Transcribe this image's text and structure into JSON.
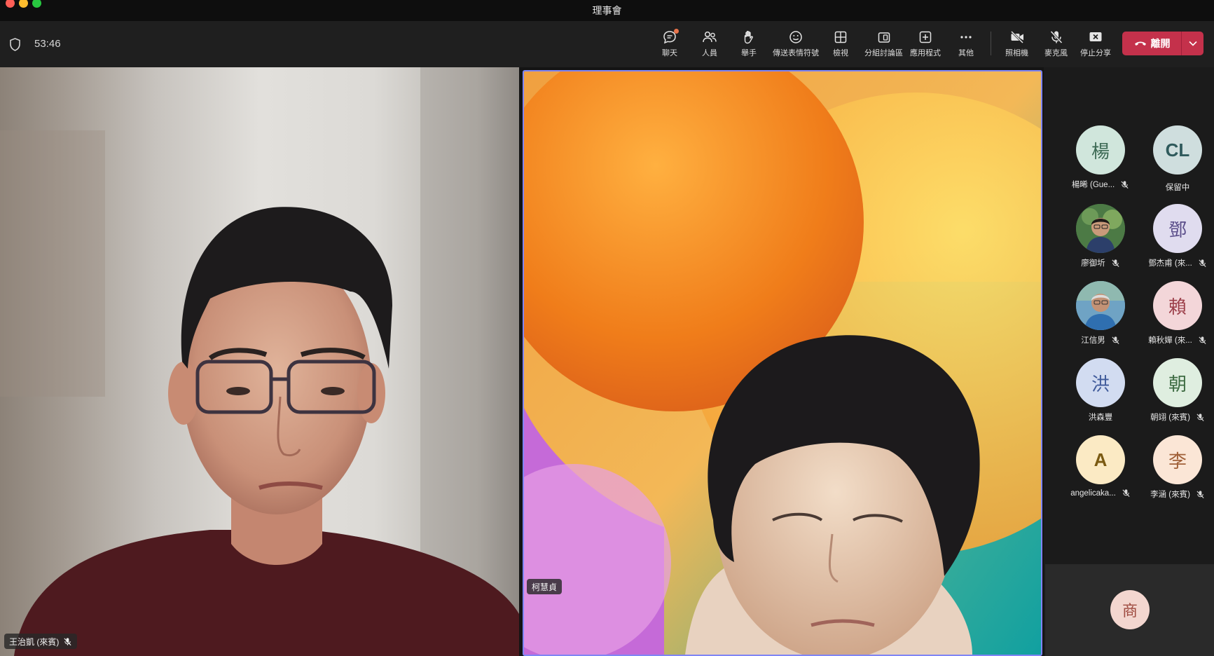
{
  "window": {
    "title": "理事會"
  },
  "meeting": {
    "timer": "53:46"
  },
  "toolbar": {
    "chat": "聊天",
    "people": "人員",
    "raise_hand": "舉手",
    "reactions": "傳送表情符號",
    "view": "檢視",
    "breakout": "分組討論區",
    "apps": "應用程式",
    "more": "其他",
    "camera": "照相機",
    "mic": "麥克風",
    "stop_share": "停止分享",
    "leave": "離開"
  },
  "stage": {
    "left_name": "王治凱 (來賓)",
    "right_name": "柯慧貞"
  },
  "roster": [
    {
      "initial": "楊",
      "name": "楊晞 (Gue...",
      "muted": true
    },
    {
      "initial": "CL",
      "name": "保留中",
      "muted": false
    },
    {
      "initial": "",
      "name": "廖御圻",
      "muted": true
    },
    {
      "initial": "鄧",
      "name": "鄧杰甫 (來...",
      "muted": true
    },
    {
      "initial": "",
      "name": "江信男",
      "muted": true
    },
    {
      "initial": "賴",
      "name": "賴秋嬋 (來...",
      "muted": true
    },
    {
      "initial": "洪",
      "name": "洪森豐",
      "muted": false
    },
    {
      "initial": "朝",
      "name": "朝翊 (來賓)",
      "muted": true
    },
    {
      "initial": "A",
      "name": "angelicaka...",
      "muted": true
    },
    {
      "initial": "李",
      "name": "李涵 (來賓)",
      "muted": true
    }
  ],
  "overflow": {
    "initial": "商"
  },
  "colors": {
    "leave_red": "#c4314b",
    "active_speaker_border": "#7f85f5",
    "badge_orange": "#e8744b"
  }
}
